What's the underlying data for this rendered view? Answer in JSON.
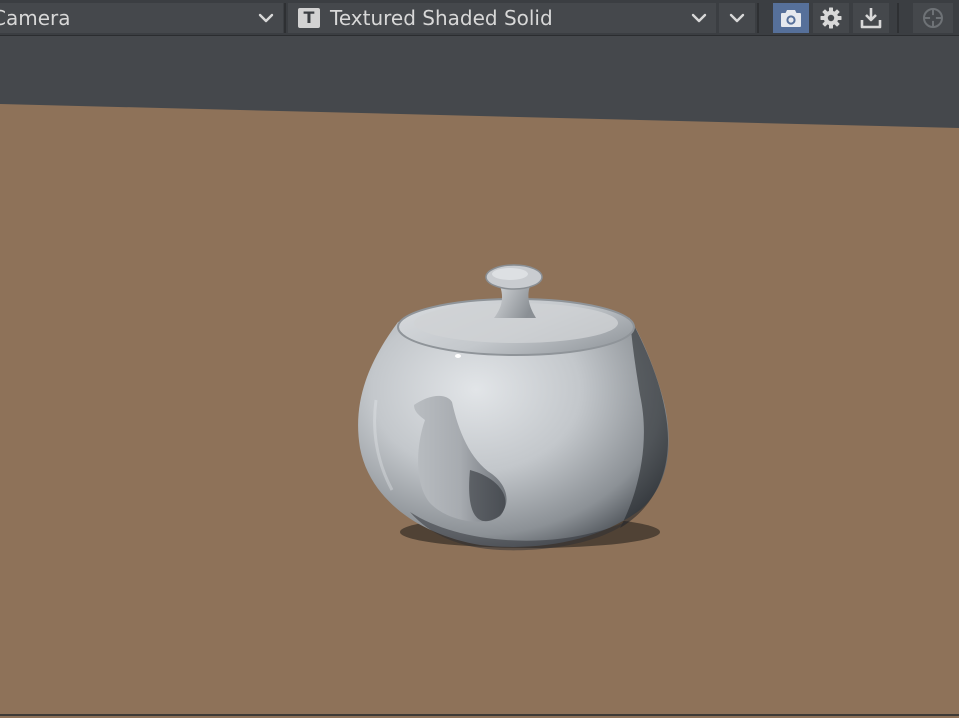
{
  "toolbar": {
    "camera_view": "Camera",
    "render_mode": "Textured Shaded Solid",
    "render_badge": "T",
    "icons": {
      "camera_chevron": "chevron-down-icon",
      "render_chevron": "chevron-down-icon",
      "menu": "chevron-down-icon",
      "camera": "camera-icon",
      "settings": "gear-icon",
      "export": "download-icon",
      "center": "crosshair-icon"
    },
    "active_button": "camera"
  },
  "viewport": {
    "object": "teapot",
    "colors": {
      "background": "#45484c",
      "ground": "#8e7259",
      "object": "#c8cbce"
    }
  }
}
